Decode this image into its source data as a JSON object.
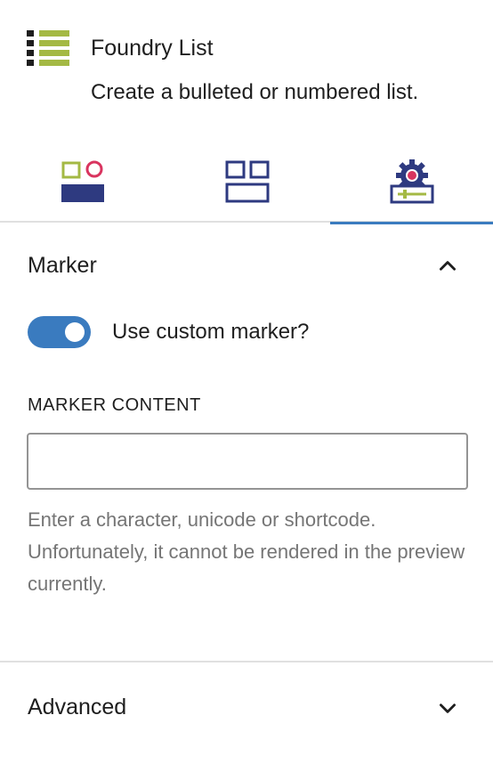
{
  "block": {
    "title": "Foundry List",
    "description": "Create a bulleted or numbered list.",
    "icon": "bulleted-list-icon"
  },
  "tabs": [
    {
      "icon": "styles-icon",
      "active": false
    },
    {
      "icon": "layout-icon",
      "active": false
    },
    {
      "icon": "settings-icon",
      "active": true
    }
  ],
  "marker_panel": {
    "title": "Marker",
    "expanded": true,
    "toggle_label": "Use custom marker?",
    "toggle_on": true,
    "field_label": "MARKER CONTENT",
    "field_value": "",
    "help_text": "Enter a character, unicode or shortcode. Unfortunately, it cannot be rendered in the preview currently."
  },
  "advanced_panel": {
    "title": "Advanced",
    "expanded": false
  },
  "colors": {
    "accent": "#3a7bbf",
    "navy": "#2e3a80",
    "olive": "#a4b944",
    "pink": "#d9345f"
  }
}
